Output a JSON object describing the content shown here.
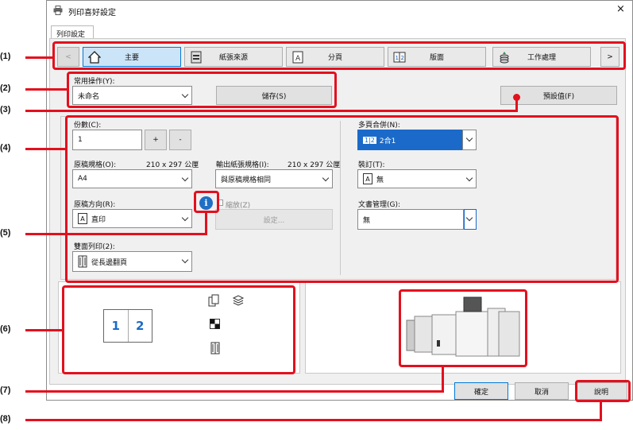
{
  "window": {
    "title": "列印喜好設定",
    "close": "×"
  },
  "settings_tab": "列印設定",
  "tabs": [
    {
      "label": "主要",
      "icon": "home-icon"
    },
    {
      "label": "紙張來源",
      "icon": "paper-tray-icon"
    },
    {
      "label": "分頁",
      "icon": "page-a-icon"
    },
    {
      "label": "版面",
      "icon": "layout-12-icon"
    },
    {
      "label": "工作處理",
      "icon": "job-stack-icon"
    }
  ],
  "scroll_left": "<",
  "scroll_right": ">",
  "favorites": {
    "label": "常用操作(Y):",
    "value": "未命名",
    "save": "儲存(S)"
  },
  "defaults_button": "預設值(F)",
  "copies": {
    "label": "份數(C):",
    "value": "1",
    "plus": "+",
    "minus": "-"
  },
  "original_size": {
    "label": "原稿規格(O):",
    "dim": "210 x 297 公厘",
    "value": "A4"
  },
  "output_size": {
    "label": "輸出紙張規格(I):",
    "dim": "210 x 297 公厘",
    "value": "與原稿規格相同"
  },
  "orientation": {
    "label": "原稿方向(R):",
    "value": "直印"
  },
  "zoom": {
    "label": "縮放(Z)",
    "button": "設定..."
  },
  "duplex": {
    "label": "雙面列印(2):",
    "value": "從長邊翻頁"
  },
  "nup": {
    "label": "多頁合併(N):",
    "value": "2合1",
    "icon_text": "1|2"
  },
  "staple": {
    "label": "裝訂(T):",
    "value": "無"
  },
  "document_filing": {
    "label": "文書管理(G):",
    "value": "無"
  },
  "preview": {
    "page_left": "1",
    "page_right": "2"
  },
  "footer": {
    "ok": "確定",
    "cancel": "取消",
    "help": "說明"
  },
  "callouts": [
    "(1)",
    "(2)",
    "(3)",
    "(4)",
    "(5)",
    "(6)",
    "(7)",
    "(8)"
  ],
  "colors": {
    "highlight": "#e3101e",
    "accent": "#0078d7",
    "selected": "#cce4f7"
  }
}
